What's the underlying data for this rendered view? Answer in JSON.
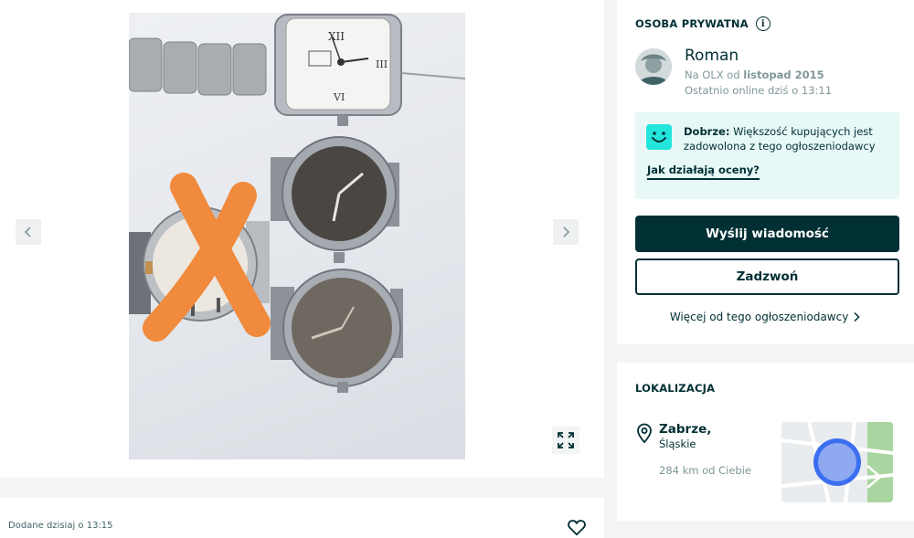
{
  "gallery": {
    "image_alt": "Zegarki",
    "prev_icon": "chevron-left-icon",
    "next_icon": "chevron-right-icon",
    "expand_icon": "expand-icon"
  },
  "meta": {
    "added": "Dodane dzisiaj o 13:15",
    "favorite_icon": "heart-icon"
  },
  "seller": {
    "type": "OSOBA PRYWATNA",
    "name": "Roman",
    "member_since_prefix": "Na OLX od",
    "member_since": "listopad 2015",
    "last_online": "Ostatnio online dziś o 13:11",
    "rating_label": "Dobrze:",
    "rating_text": "Większość kupujących jest zadowolona z tego ogłoszeniodawcy",
    "rating_link": "Jak działają oceny?",
    "message_button": "Wyślij wiadomość",
    "call_button": "Zadzwoń",
    "more_link": "Więcej od tego ogłoszeniodawcy"
  },
  "location": {
    "title": "LOKALIZACJA",
    "city": "Zabrze,",
    "region": "Śląskie",
    "distance": "284 km od Ciebie"
  },
  "colors": {
    "primary": "#002f34",
    "accent": "#23e5db",
    "rating_bg": "#e7f8f6",
    "muted": "#7f9799"
  }
}
